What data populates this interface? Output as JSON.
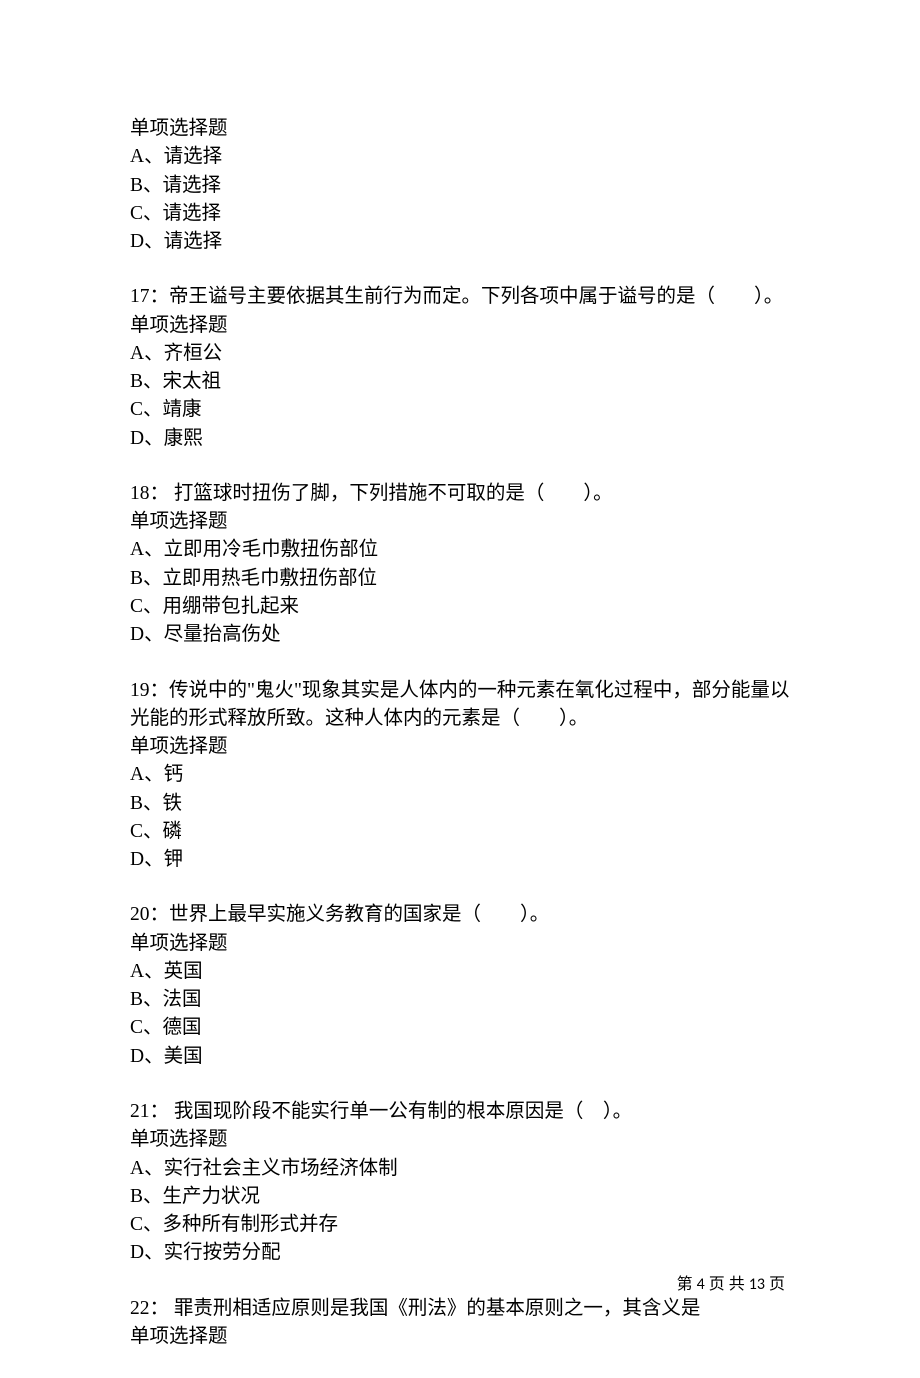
{
  "questions": [
    {
      "stem": "",
      "type": "单项选择题",
      "options": [
        "A、请选择",
        "B、请选择",
        "C、请选择",
        "D、请选择"
      ]
    },
    {
      "stem": "17：帝王谥号主要依据其生前行为而定。下列各项中属于谥号的是（　　）。",
      "type": "单项选择题",
      "options": [
        "A、齐桓公",
        "B、宋太祖",
        "C、靖康",
        "D、康熙"
      ]
    },
    {
      "stem": "18： 打篮球时扭伤了脚，下列措施不可取的是（　　）。",
      "type": "单项选择题",
      "options": [
        "A、立即用冷毛巾敷扭伤部位",
        "B、立即用热毛巾敷扭伤部位",
        "C、用绷带包扎起来",
        "D、尽量抬高伤处"
      ]
    },
    {
      "stem": "19：传说中的\"鬼火\"现象其实是人体内的一种元素在氧化过程中，部分能量以光能的形式释放所致。这种人体内的元素是（　　）。",
      "type": "单项选择题",
      "options": [
        "A、钙",
        "B、铁",
        "C、磷",
        "D、钾"
      ]
    },
    {
      "stem": "20：世界上最早实施义务教育的国家是（　　）。",
      "type": "单项选择题",
      "options": [
        "A、英国",
        "B、法国",
        "C、德国",
        "D、美国"
      ]
    },
    {
      "stem": "21： 我国现阶段不能实行单一公有制的根本原因是（　）。",
      "type": "单项选择题",
      "options": [
        "A、实行社会主义市场经济体制",
        "B、生产力状况",
        "C、多种所有制形式并存",
        "D、实行按劳分配"
      ]
    },
    {
      "stem": "22： 罪责刑相适应原则是我国《刑法》的基本原则之一，其含义是",
      "type": "单项选择题",
      "options": []
    }
  ],
  "footer": {
    "prefix": "第 ",
    "page": "4",
    "middle": " 页 共 ",
    "total": "13",
    "suffix": " 页"
  }
}
